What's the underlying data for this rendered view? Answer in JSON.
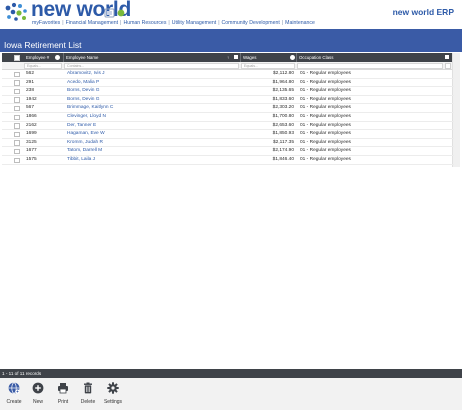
{
  "header": {
    "logo_text": "new world",
    "product_title": "new world ERP",
    "nav": [
      "myFavorites",
      "Financial Management",
      "Human Resources",
      "Utility Management",
      "Community Development",
      "Maintenance"
    ]
  },
  "page": {
    "title": "Iowa Retirement List"
  },
  "grid": {
    "columns": {
      "employee_no": "Employee #",
      "employee_name": "Employee Name",
      "wages": "Wages",
      "occupation_class": "Occupation Class"
    },
    "filters": {
      "employee_no": "Equals...",
      "employee_name": "Contains...",
      "wages": "Equals..."
    },
    "rows": [
      {
        "id": "562",
        "name": "Abramovitz, Ivis J",
        "wages": "$2,112.80",
        "occ": "01 - Regular employees"
      },
      {
        "id": "291",
        "name": "Acedo, Malia P",
        "wages": "$1,964.80",
        "occ": "01 - Regular employees"
      },
      {
        "id": "238",
        "name": "Borns, Devin G",
        "wages": "$2,135.65",
        "occ": "01 - Regular employees"
      },
      {
        "id": "1942",
        "name": "Borns, Devin G",
        "wages": "$1,833.60",
        "occ": "01 - Regular employees"
      },
      {
        "id": "567",
        "name": "Brimmage, Kaitlynn C",
        "wages": "$2,303.20",
        "occ": "01 - Regular employees"
      },
      {
        "id": "1866",
        "name": "Clevinger, Lloyd N",
        "wages": "$1,700.80",
        "occ": "01 - Regular employees"
      },
      {
        "id": "2162",
        "name": "Der, Tanner E",
        "wages": "$2,653.60",
        "occ": "01 - Regular employees"
      },
      {
        "id": "1699",
        "name": "Hagaman, Eve W",
        "wages": "$1,850.93",
        "occ": "01 - Regular employees"
      },
      {
        "id": "3125",
        "name": "Kromm, Judah R",
        "wages": "$2,117.35",
        "occ": "01 - Regular employees"
      },
      {
        "id": "1677",
        "name": "Tatom, Darrell M",
        "wages": "$2,174.90",
        "occ": "01 - Regular employees"
      },
      {
        "id": "1575",
        "name": "Tibbit, Laila J",
        "wages": "$1,846.40",
        "occ": "01 - Regular employees"
      }
    ]
  },
  "footer": {
    "record_count": "1 - 11 of 11 records",
    "toolbar": [
      "Create",
      "New",
      "Print",
      "Delete",
      "Settings"
    ]
  },
  "colors": {
    "brand": "#2d5aa8",
    "bar": "#3a5ba6",
    "grid_header": "#3f4349"
  },
  "icons": [
    "new-world-logo",
    "globe-icon",
    "plus-icon",
    "printer-icon",
    "trash-icon",
    "gear-icon"
  ]
}
